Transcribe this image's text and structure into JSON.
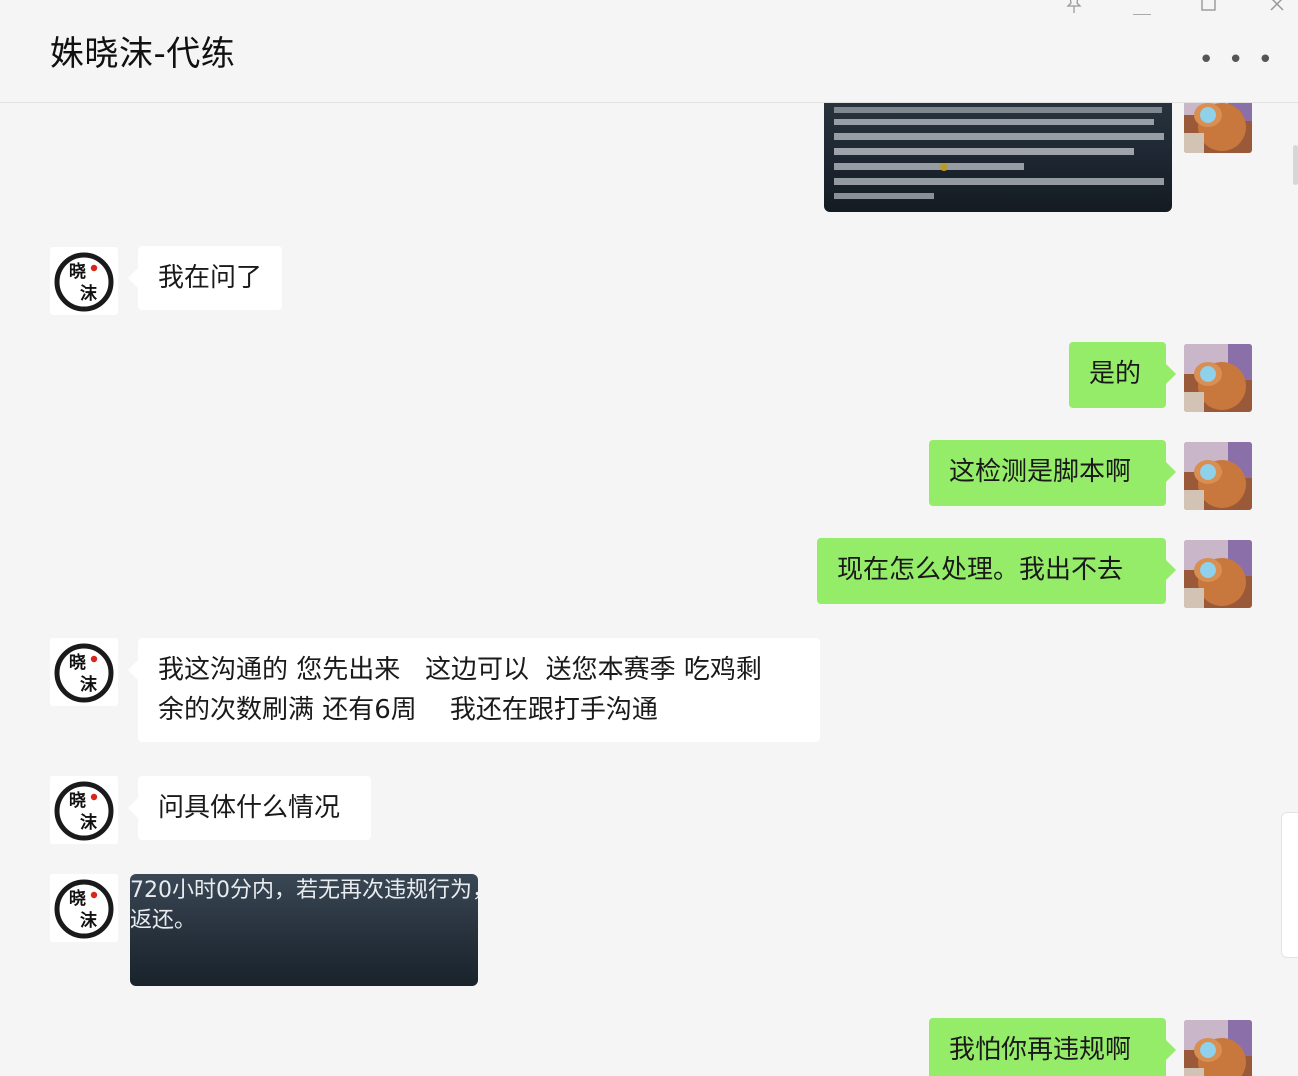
{
  "header": {
    "title": "姝晓沫-代练",
    "more_label": "• • •",
    "pin_icon": "pin-icon",
    "minimize_icon": "minimize-icon",
    "maximize_icon": "maximize-icon",
    "close_icon": "close-icon"
  },
  "avatars": {
    "contact_glyph_top": "晓",
    "contact_glyph_bottom": "沫"
  },
  "messages": [
    {
      "side": "out",
      "type": "image",
      "label": "screenshot-notice"
    },
    {
      "side": "in",
      "type": "text",
      "text": "我在问了"
    },
    {
      "side": "out",
      "type": "text",
      "text": "是的"
    },
    {
      "side": "out",
      "type": "text",
      "text": "这检测是脚本啊"
    },
    {
      "side": "out",
      "type": "text",
      "text": "现在怎么处理。我出不去"
    },
    {
      "side": "in",
      "type": "text",
      "line1": "我这沟通的 您先出来   这边可以  送您本赛季 吃鸡剩",
      "line2": "余的次数刷满 还有6周    我还在跟打手沟通"
    },
    {
      "side": "in",
      "type": "text",
      "text": "问具体什么情况"
    },
    {
      "side": "in",
      "type": "image",
      "line1": "720小时0分内，若无再次违规行为，",
      "line2": "返还。"
    },
    {
      "side": "out",
      "type": "text",
      "text": "我怕你再违规啊"
    }
  ],
  "colors": {
    "outgoing_bubble": "#95ec69",
    "incoming_bubble": "#ffffff",
    "background": "#f5f5f5"
  }
}
